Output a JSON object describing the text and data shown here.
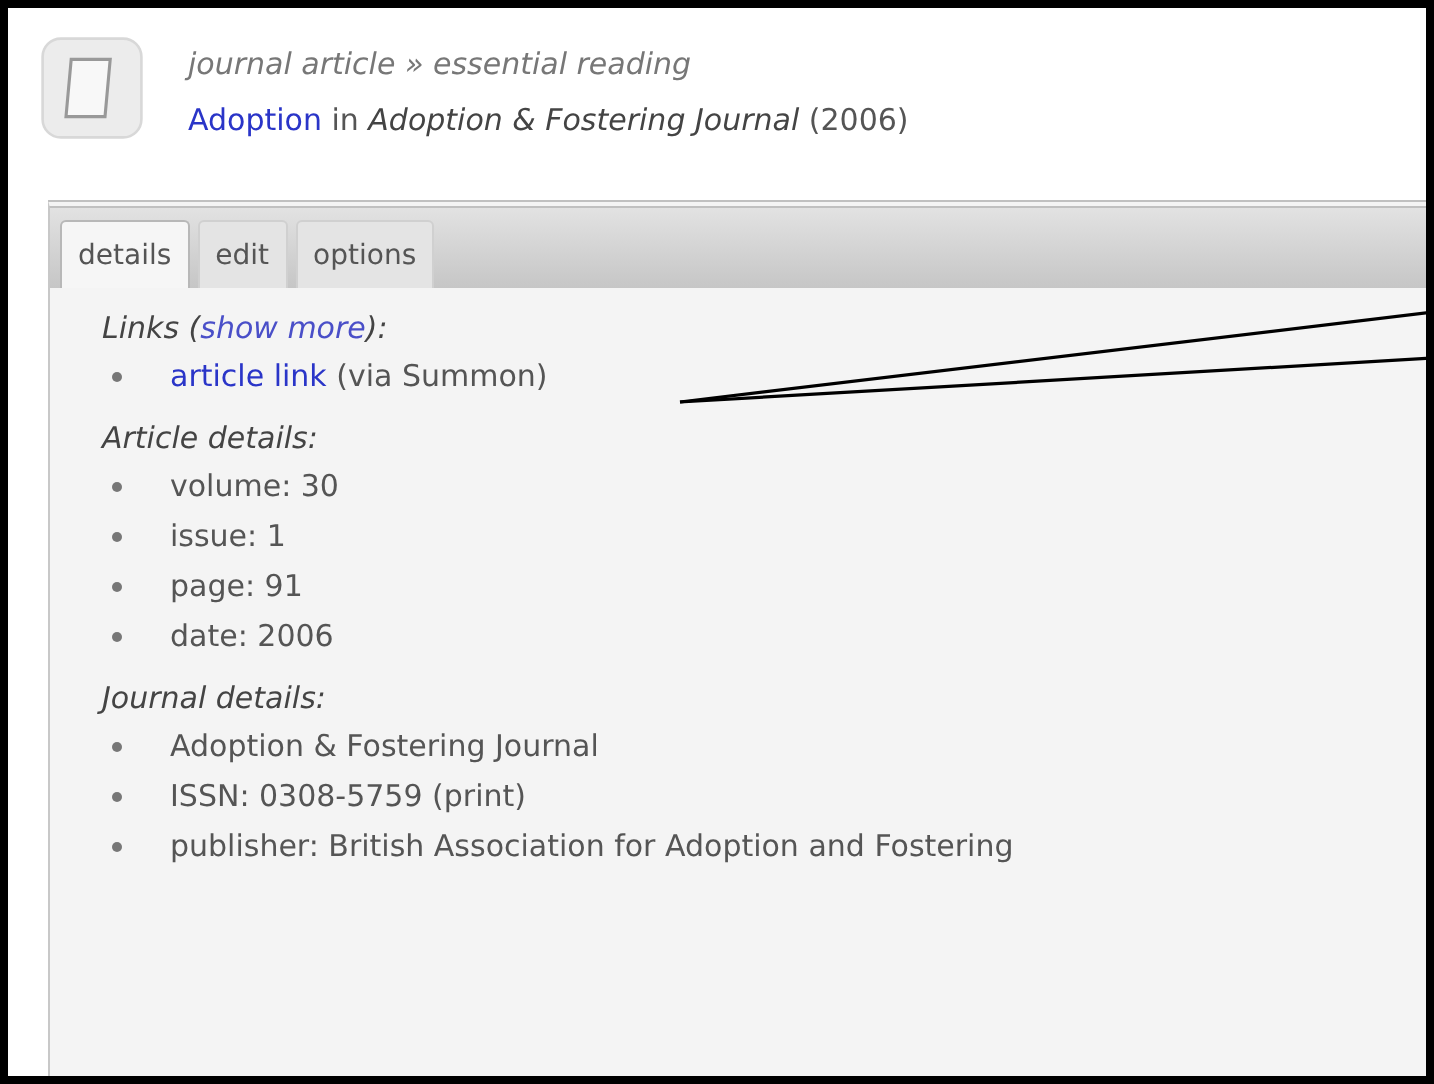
{
  "header": {
    "breadcrumb": "journal article » essential reading",
    "title": "Adoption",
    "connector": "in",
    "journal": "Adoption & Fostering Journal",
    "year": "(2006)"
  },
  "tabs": [
    {
      "label": "details",
      "selected": true
    },
    {
      "label": "edit",
      "selected": false
    },
    {
      "label": "options",
      "selected": false
    }
  ],
  "sections": [
    {
      "heading": "Links (",
      "heading_link": "show more",
      "heading_end": "):",
      "items": [
        {
          "kind": "link",
          "link": "article link",
          "text": "(via Summon)"
        }
      ]
    },
    {
      "heading": "Article details:",
      "items": [
        {
          "kind": "text",
          "text": "volume: 30"
        },
        {
          "kind": "text",
          "text": "issue: 1"
        },
        {
          "kind": "text",
          "text": "page: 91"
        },
        {
          "kind": "text",
          "text": "date: 2006"
        }
      ]
    },
    {
      "heading": "Journal details:",
      "items": [
        {
          "kind": "text",
          "text": "Adoption & Fostering Journal"
        },
        {
          "kind": "text",
          "text": "ISSN: 0308-5759 (print)"
        },
        {
          "kind": "text",
          "text": "publisher: British Association for Adoption and Fostering"
        }
      ]
    }
  ]
}
